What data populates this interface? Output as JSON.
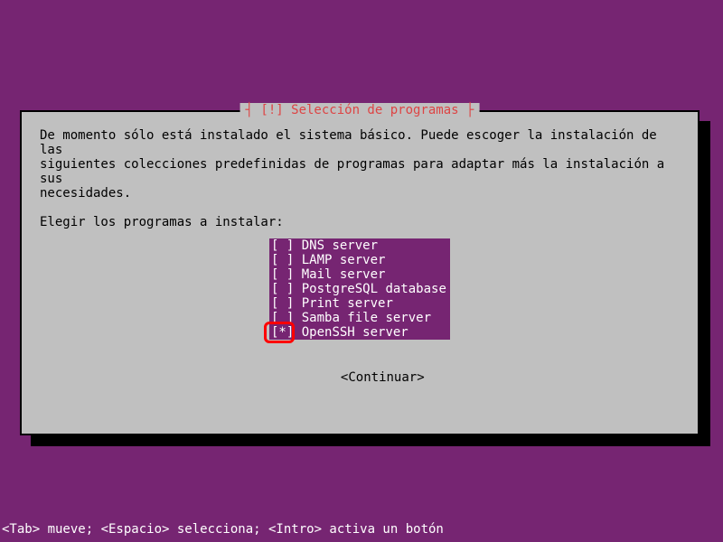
{
  "dialog": {
    "title": "┤ [!] Selección de programas ├",
    "description_line1": "De momento sólo está instalado el sistema básico. Puede escoger la instalación de las",
    "description_line2": "siguientes colecciones predefinidas de programas para adaptar más la instalación a sus",
    "description_line3": "necesidades.",
    "prompt": "Elegir los programas a instalar:",
    "items": [
      {
        "checkbox": "[ ]",
        "label": "DNS server"
      },
      {
        "checkbox": "[ ]",
        "label": "LAMP server"
      },
      {
        "checkbox": "[ ]",
        "label": "Mail server"
      },
      {
        "checkbox": "[ ]",
        "label": "PostgreSQL database"
      },
      {
        "checkbox": "[ ]",
        "label": "Print server"
      },
      {
        "checkbox": "[ ]",
        "label": "Samba file server"
      },
      {
        "checkbox": "[*]",
        "label": "OpenSSH server"
      }
    ],
    "continue_label": "<Continuar>"
  },
  "help": "<Tab> mueve; <Espacio> selecciona; <Intro> activa un botón",
  "highlight_index": 6
}
